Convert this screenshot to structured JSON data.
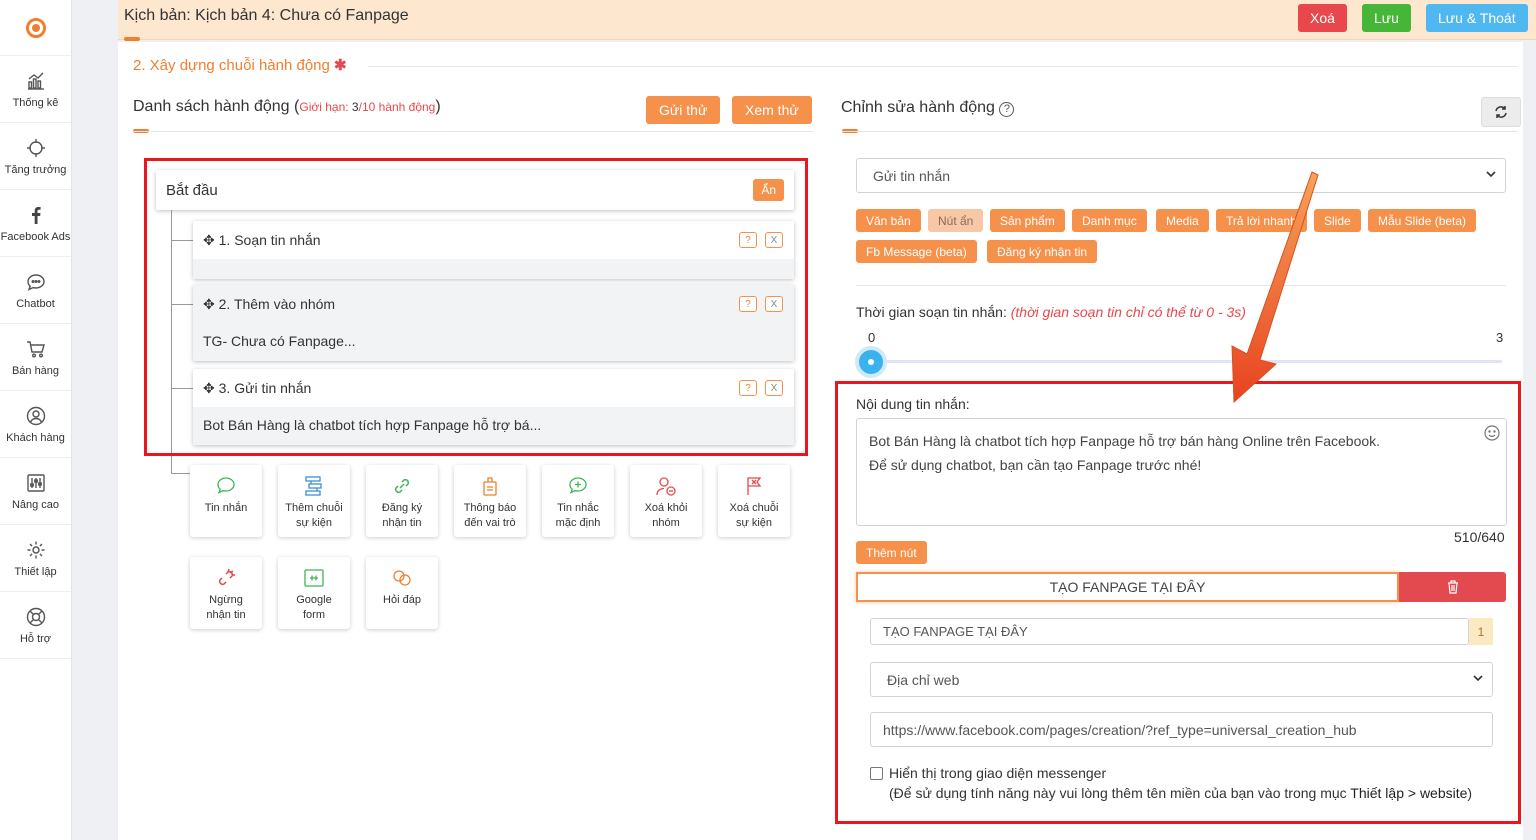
{
  "sidebar": {
    "items": [
      {
        "label": "Thống kê",
        "icon": "chart-icon"
      },
      {
        "label": "Tăng trưởng",
        "icon": "crosshair-icon"
      },
      {
        "label": "Facebook Ads",
        "icon": "facebook-icon"
      },
      {
        "label": "Chatbot",
        "icon": "chat-icon"
      },
      {
        "label": "Bán hàng",
        "icon": "cart-icon"
      },
      {
        "label": "Khách hàng",
        "icon": "user-icon"
      },
      {
        "label": "Nâng cao",
        "icon": "sliders-icon"
      },
      {
        "label": "Thiết lập",
        "icon": "gear-icon"
      },
      {
        "label": "Hỗ trợ",
        "icon": "lifebuoy-icon"
      }
    ]
  },
  "header": {
    "title": "Kịch bản: Kịch bản 4: Chưa có Fanpage",
    "delete_label": "Xoá",
    "save_label": "Lưu",
    "save_exit_label": "Lưu & Thoát",
    "colors": {
      "delete": "#e8474b",
      "save": "#46b638",
      "save_exit": "#4fb8f0"
    }
  },
  "section": {
    "title": "2. Xây dựng chuỗi hành động",
    "required_mark": "✱"
  },
  "actions_panel": {
    "title": "Danh sách hành động",
    "limit_prefix": "Giới hạn: ",
    "limit_used": "3",
    "limit_rest": "/10 hành động",
    "send_test_label": "Gửi thử",
    "preview_label": "Xem thử",
    "start_label": "Bắt đầu",
    "hide_label": "Ẩn",
    "help_label": "?",
    "remove_label": "X",
    "actions": [
      {
        "name": "1. Soạn tin nhắn",
        "preview": ""
      },
      {
        "name": "2. Thêm vào nhóm",
        "preview": "TG- Chưa có Fanpage..."
      },
      {
        "name": "3. Gửi tin nhắn",
        "preview": "Bot Bán Hàng là chatbot tích hợp Fanpage hỗ trợ bá..."
      }
    ],
    "tools": [
      {
        "label": "Tin nhắn",
        "icon": "message-icon"
      },
      {
        "label": "Thêm chuỗi\nsự kiện",
        "icon": "flow-icon"
      },
      {
        "label": "Đăng ký\nnhận tin",
        "icon": "link-icon"
      },
      {
        "label": "Thông báo\nđến vai trò",
        "icon": "badge-icon"
      },
      {
        "label": "Tin nhắc\nmặc định",
        "icon": "message-plus-icon"
      },
      {
        "label": "Xoá khỏi\nnhóm",
        "icon": "user-remove-icon"
      },
      {
        "label": "Xoá chuỗi\nsự kiện",
        "icon": "flag-remove-icon"
      },
      {
        "label": "Ngừng\nnhận tin",
        "icon": "unlink-icon"
      },
      {
        "label": "Google\nform",
        "icon": "form-icon"
      },
      {
        "label": "Hỏi đáp",
        "icon": "qa-icon"
      }
    ]
  },
  "editor": {
    "title": "Chỉnh sửa hành động",
    "action_type": "Gửi tin nhắn",
    "tags": [
      "Văn bản",
      "Nút ẩn",
      "Sản phẩm",
      "Danh mục",
      "Media",
      "Trả lời nhanh",
      "Slide",
      "Mẫu Slide (beta)",
      "Fb Message (beta)",
      "Đăng ký nhận tin"
    ],
    "typing_label": "Thời gian soạn tin nhắn: ",
    "typing_hint": "(thời gian soạn tin chỉ có thể từ 0 - 3s)",
    "slider_min": "0",
    "slider_max": "3",
    "slider_value": 0,
    "content_label": "Nội dung tin nhắn:",
    "content_line1": "Bot Bán Hàng là chatbot tích hợp Fanpage hỗ trợ bán hàng Online trên Facebook.",
    "content_line2": "Để sử dụng chatbot, bạn cần tạo Fanpage trước nhé!",
    "char_count": "510/640",
    "add_button_label": "Thêm nút",
    "button_title": "TẠO FANPAGE TẠI ĐÂY",
    "button_title_field": "TẠO FANPAGE TẠI ĐÂY",
    "button_title_count": "1",
    "button_type": "Địa chỉ web",
    "button_url": "https://www.facebook.com/pages/creation/?ref_type=universal_creation_hub",
    "messenger_checkbox_label": "Hiển thị trong giao diện messenger",
    "messenger_note_prefix": "(Để sử dụng tính năng này vui lòng thêm tên miền của bạn vào trong mục ",
    "messenger_note_link": "Thiết lập > website",
    "messenger_note_suffix": ")"
  }
}
